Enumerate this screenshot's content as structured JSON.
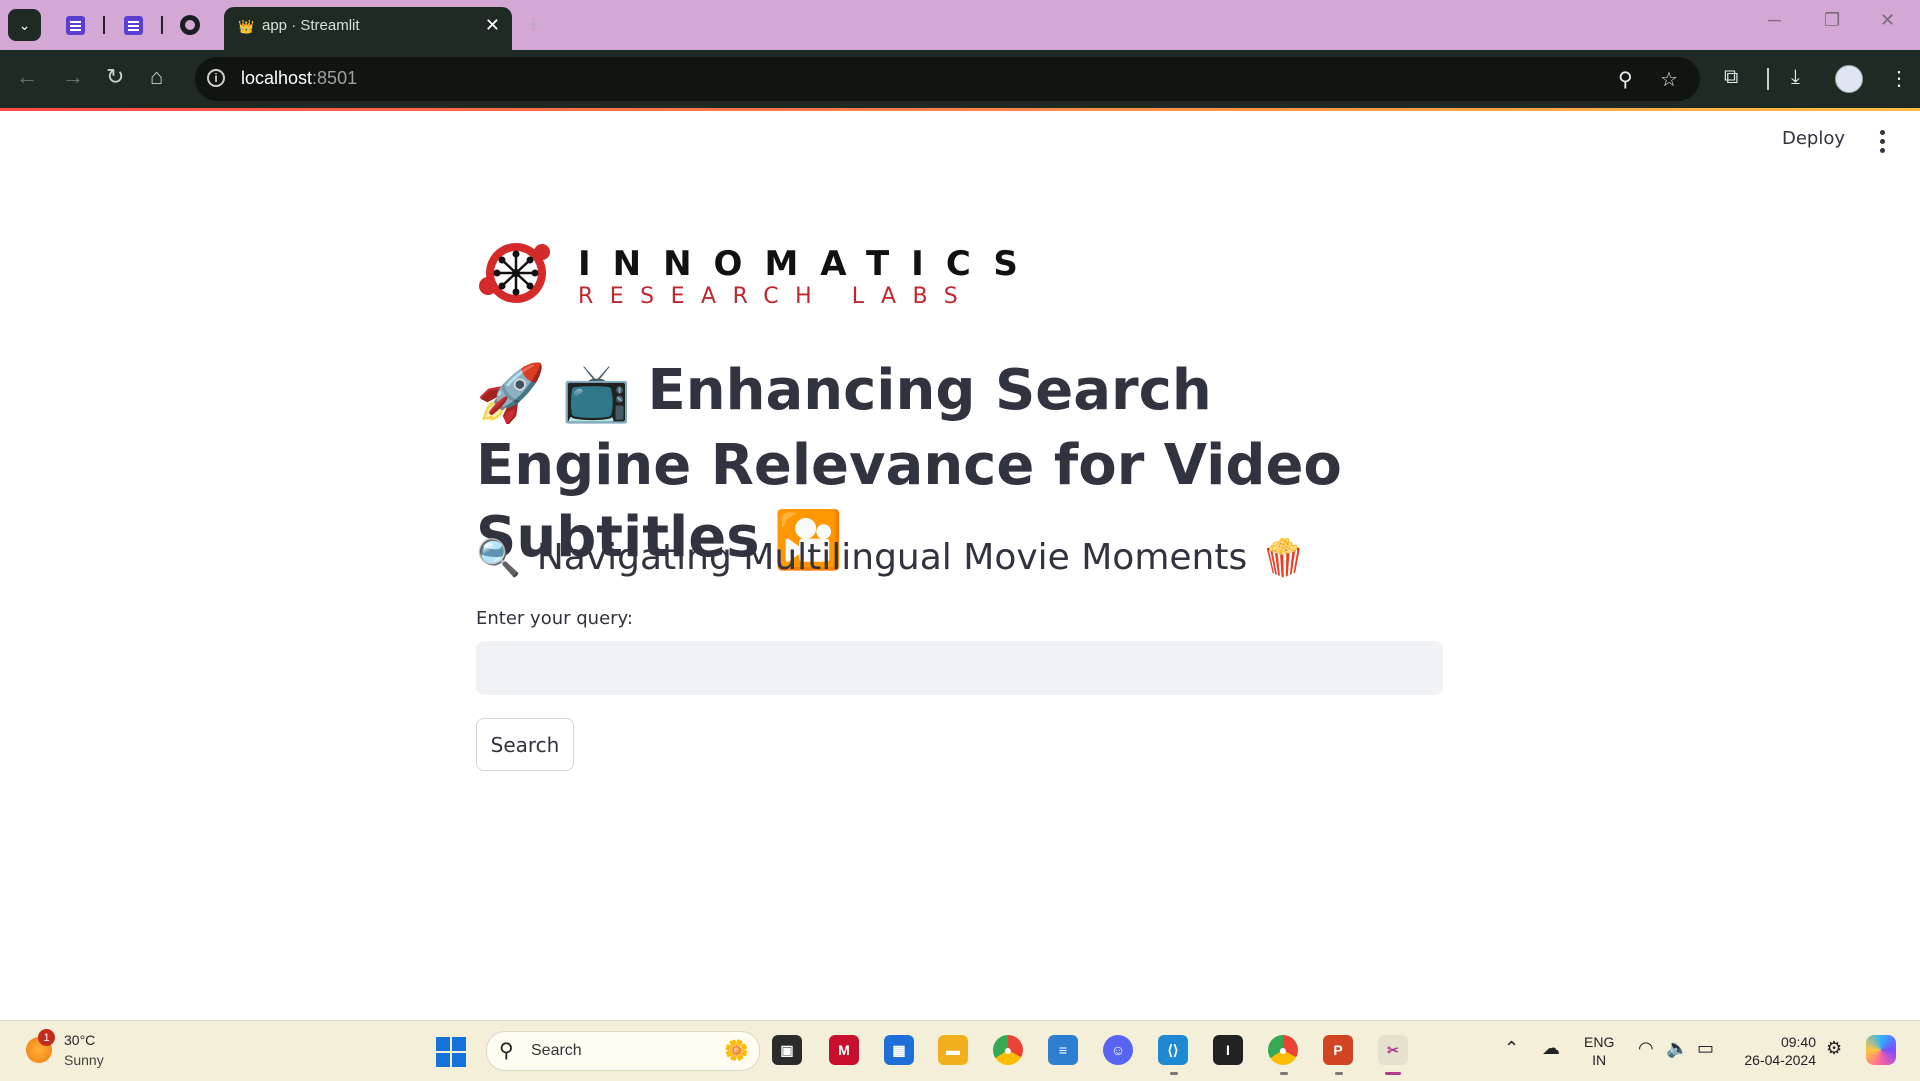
{
  "browser": {
    "tab_title": "app · Streamlit",
    "tab_favicon": "👑",
    "url_host": "localhost",
    "url_port": ":8501",
    "close_glyph": "✕",
    "new_tab_glyph": "+"
  },
  "header": {
    "deploy_label": "Deploy"
  },
  "logo": {
    "line1": "INNOMATICS",
    "line2": "RESEARCH LABS"
  },
  "main": {
    "title_emoji_1": "🚀",
    "title_emoji_2": "📺",
    "title_text": "Enhancing Search Engine Relevance for Video Subtitles",
    "title_emoji_3": "🎦",
    "subheading_emoji_1": "🔍",
    "subheading_text": "Navigating Multilingual Movie Moments",
    "subheading_emoji_2": "🍿",
    "query_label": "Enter your query:",
    "query_value": "",
    "search_button": "Search"
  },
  "taskbar": {
    "weather_temp": "30°C",
    "weather_desc": "Sunny",
    "weather_badge": "1",
    "search_label": "Search",
    "lang_1": "ENG",
    "lang_2": "IN",
    "time": "09:40",
    "date": "26-04-2024"
  },
  "colors": {
    "accent_gradient_start": "#ff4b4b",
    "accent_gradient_end": "#ffbd45",
    "tabstrip": "#d4a8d4",
    "toolbar": "#1f2a24",
    "text": "#31333f",
    "input_bg": "#f0f2f6"
  }
}
